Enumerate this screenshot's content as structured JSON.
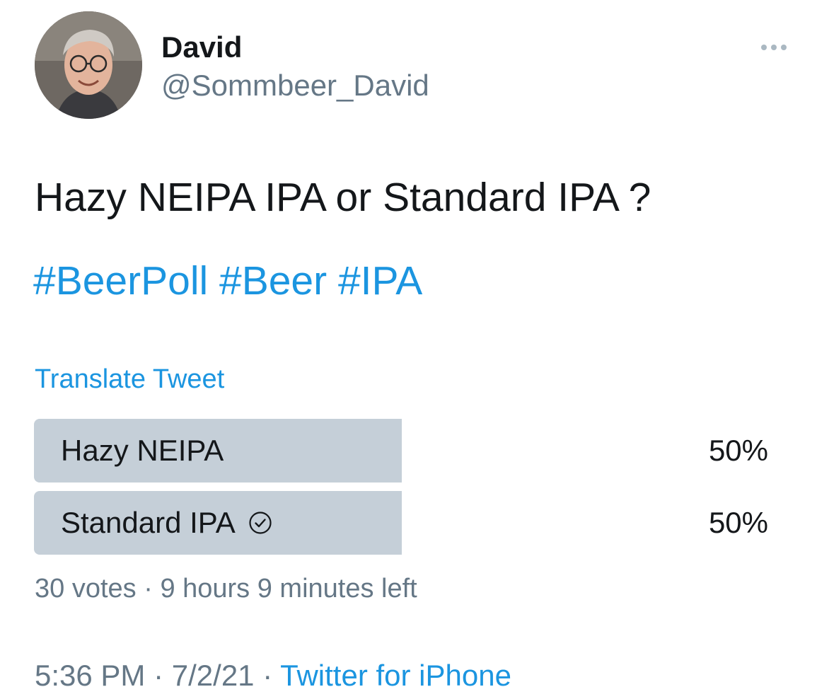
{
  "author": {
    "display_name": "David",
    "handle": "@Sommbeer_David"
  },
  "tweet": {
    "text": "Hazy NEIPA IPA or Standard IPA ?",
    "hashtags": [
      "#BeerPoll",
      "#Beer",
      "#IPA"
    ],
    "translate_label": "Translate Tweet"
  },
  "poll": {
    "options": [
      {
        "label": "Hazy NEIPA",
        "percent_text": "50%",
        "percent": 50,
        "selected": false
      },
      {
        "label": "Standard IPA",
        "percent_text": "50%",
        "percent": 50,
        "selected": true
      }
    ],
    "votes": "30 votes",
    "separator": "·",
    "time_left": "9 hours 9 minutes left",
    "fill_color": "#c5cfd8",
    "selected_icon": "check-circle-icon"
  },
  "footer": {
    "time": "5:36 PM",
    "date": "7/2/21",
    "separator": "·",
    "source": "Twitter for iPhone"
  },
  "colors": {
    "link": "#1b95e0",
    "secondary_text": "#657786",
    "primary_text": "#14171a"
  },
  "icons": {
    "more": "more-horizontal-icon",
    "avatar": "avatar"
  }
}
